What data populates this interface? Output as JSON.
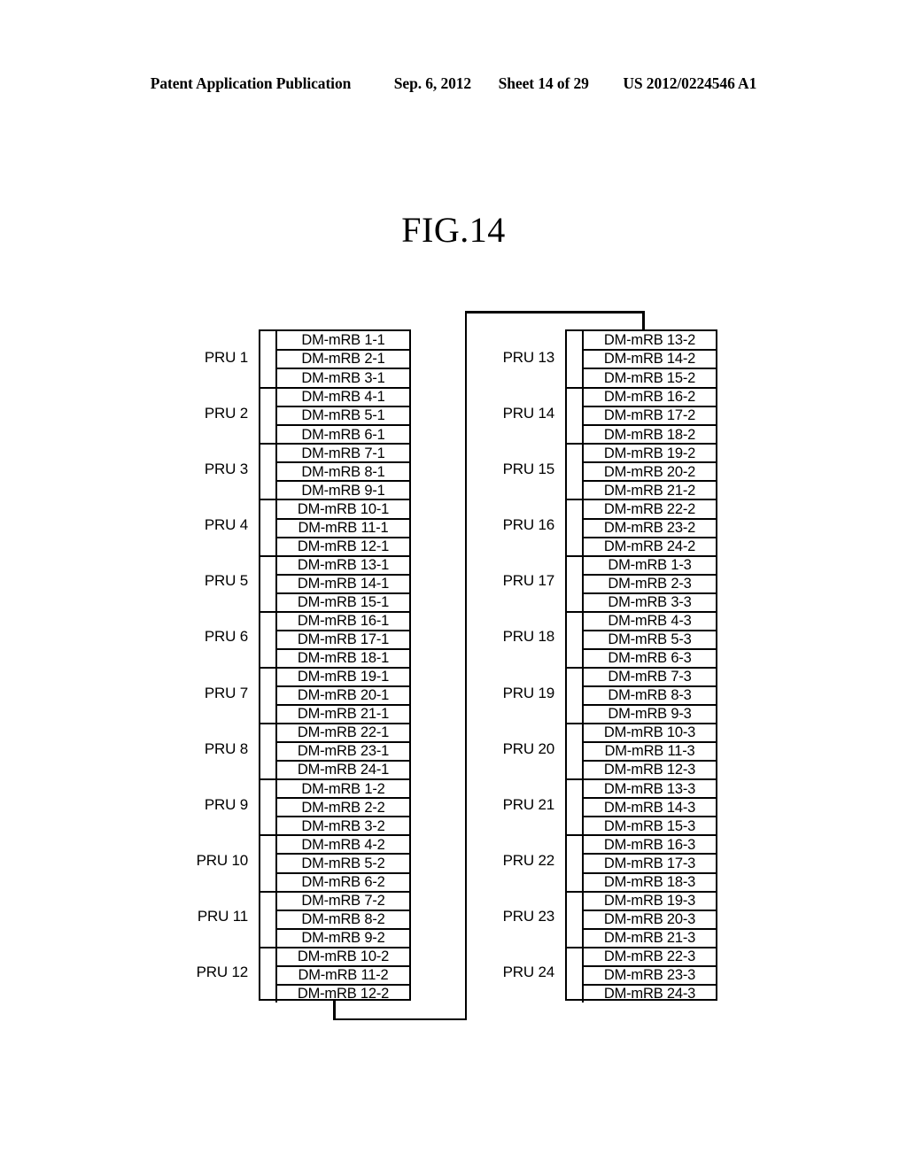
{
  "header": {
    "publication": "Patent Application Publication",
    "date": "Sep. 6, 2012",
    "sheet": "Sheet 14 of 29",
    "doc_number": "US 2012/0224546 A1"
  },
  "figure": {
    "title": "FIG.14"
  },
  "diagram": {
    "rows_per_pru": 3,
    "left_table": {
      "groups": [
        {
          "pru_label": "PRU 1",
          "cells": [
            "DM-mRB 1-1",
            "DM-mRB 2-1",
            "DM-mRB 3-1"
          ]
        },
        {
          "pru_label": "PRU 2",
          "cells": [
            "DM-mRB 4-1",
            "DM-mRB 5-1",
            "DM-mRB 6-1"
          ]
        },
        {
          "pru_label": "PRU 3",
          "cells": [
            "DM-mRB 7-1",
            "DM-mRB 8-1",
            "DM-mRB 9-1"
          ]
        },
        {
          "pru_label": "PRU 4",
          "cells": [
            "DM-mRB 10-1",
            "DM-mRB 11-1",
            "DM-mRB 12-1"
          ]
        },
        {
          "pru_label": "PRU 5",
          "cells": [
            "DM-mRB 13-1",
            "DM-mRB 14-1",
            "DM-mRB 15-1"
          ]
        },
        {
          "pru_label": "PRU 6",
          "cells": [
            "DM-mRB 16-1",
            "DM-mRB 17-1",
            "DM-mRB 18-1"
          ]
        },
        {
          "pru_label": "PRU 7",
          "cells": [
            "DM-mRB 19-1",
            "DM-mRB 20-1",
            "DM-mRB 21-1"
          ]
        },
        {
          "pru_label": "PRU 8",
          "cells": [
            "DM-mRB 22-1",
            "DM-mRB 23-1",
            "DM-mRB 24-1"
          ]
        },
        {
          "pru_label": "PRU 9",
          "cells": [
            "DM-mRB 1-2",
            "DM-mRB 2-2",
            "DM-mRB 3-2"
          ]
        },
        {
          "pru_label": "PRU 10",
          "cells": [
            "DM-mRB 4-2",
            "DM-mRB 5-2",
            "DM-mRB 6-2"
          ]
        },
        {
          "pru_label": "PRU 11",
          "cells": [
            "DM-mRB 7-2",
            "DM-mRB 8-2",
            "DM-mRB 9-2"
          ]
        },
        {
          "pru_label": "PRU 12",
          "cells": [
            "DM-mRB 10-2",
            "DM-mRB 11-2",
            "DM-mRB 12-2"
          ]
        }
      ]
    },
    "right_table": {
      "groups": [
        {
          "pru_label": "PRU 13",
          "cells": [
            "DM-mRB 13-2",
            "DM-mRB 14-2",
            "DM-mRB 15-2"
          ]
        },
        {
          "pru_label": "PRU 14",
          "cells": [
            "DM-mRB 16-2",
            "DM-mRB 17-2",
            "DM-mRB 18-2"
          ]
        },
        {
          "pru_label": "PRU 15",
          "cells": [
            "DM-mRB 19-2",
            "DM-mRB 20-2",
            "DM-mRB 21-2"
          ]
        },
        {
          "pru_label": "PRU 16",
          "cells": [
            "DM-mRB 22-2",
            "DM-mRB 23-2",
            "DM-mRB 24-2"
          ]
        },
        {
          "pru_label": "PRU 17",
          "cells": [
            "DM-mRB 1-3",
            "DM-mRB 2-3",
            "DM-mRB 3-3"
          ]
        },
        {
          "pru_label": "PRU 18",
          "cells": [
            "DM-mRB 4-3",
            "DM-mRB 5-3",
            "DM-mRB 6-3"
          ]
        },
        {
          "pru_label": "PRU 19",
          "cells": [
            "DM-mRB 7-3",
            "DM-mRB 8-3",
            "DM-mRB 9-3"
          ]
        },
        {
          "pru_label": "PRU 20",
          "cells": [
            "DM-mRB 10-3",
            "DM-mRB 11-3",
            "DM-mRB 12-3"
          ]
        },
        {
          "pru_label": "PRU 21",
          "cells": [
            "DM-mRB 13-3",
            "DM-mRB 14-3",
            "DM-mRB 15-3"
          ]
        },
        {
          "pru_label": "PRU 22",
          "cells": [
            "DM-mRB 16-3",
            "DM-mRB 17-3",
            "DM-mRB 18-3"
          ]
        },
        {
          "pru_label": "PRU 23",
          "cells": [
            "DM-mRB 19-3",
            "DM-mRB 20-3",
            "DM-mRB 21-3"
          ]
        },
        {
          "pru_label": "PRU 24",
          "cells": [
            "DM-mRB 22-3",
            "DM-mRB 23-3",
            "DM-mRB 24-3"
          ]
        }
      ]
    }
  },
  "colors": {
    "ink": "#000000",
    "paper": "#ffffff"
  }
}
